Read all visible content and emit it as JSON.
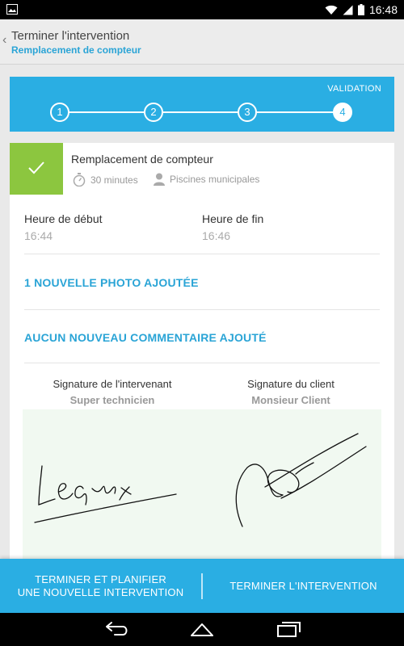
{
  "status_bar": {
    "time": "16:48",
    "icons": [
      "image-icon",
      "wifi-icon",
      "signal-icon",
      "battery-icon"
    ]
  },
  "header": {
    "title": "Terminer l'intervention",
    "subtitle": "Remplacement de compteur"
  },
  "stepper": {
    "label": "VALIDATION",
    "steps": [
      "1",
      "2",
      "3",
      "4"
    ],
    "active_step": 4
  },
  "task": {
    "title": "Remplacement de compteur",
    "duration": "30 minutes",
    "location": "Piscines municipales"
  },
  "times": {
    "start_label": "Heure de début",
    "start_value": "16:44",
    "end_label": "Heure de fin",
    "end_value": "16:46"
  },
  "photos_link": "1 NOUVELLE PHOTO AJOUTÉE",
  "comments_link": "AUCUN NOUVEAU COMMENTAIRE AJOUTÉ",
  "signatures": {
    "technician_label": "Signature de l'intervenant",
    "technician_name": "Super technicien",
    "client_label": "Signature du client",
    "client_name": "Monsieur Client"
  },
  "actions": {
    "plan_new_line1": "TERMINER ET PLANIFIER",
    "plan_new_line2": "UNE NOUVELLE INTERVENTION",
    "finish": "TERMINER L'INTERVENTION"
  },
  "colors": {
    "accent": "#2aaee3",
    "success": "#8cc63f"
  }
}
